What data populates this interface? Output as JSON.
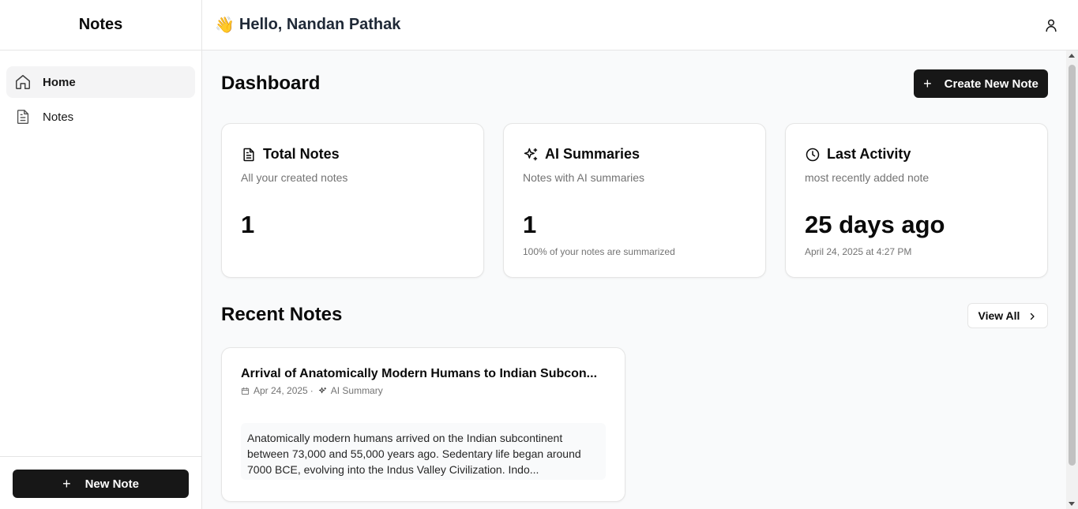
{
  "sidebar": {
    "app_title": "Notes",
    "items": [
      {
        "label": "Home",
        "icon": "home-icon",
        "active": true
      },
      {
        "label": "Notes",
        "icon": "document-icon",
        "active": false
      }
    ],
    "new_note_label": "New Note"
  },
  "header": {
    "wave": "👋",
    "greeting": "Hello, Nandan Pathak",
    "user_icon": "user-icon"
  },
  "main": {
    "title": "Dashboard",
    "create_label": "Create New Note",
    "cards": [
      {
        "title": "Total Notes",
        "icon": "file-text-icon",
        "description": "All your created notes",
        "value": "1",
        "sub": ""
      },
      {
        "title": "AI Summaries",
        "icon": "sparkles-icon",
        "description": "Notes with AI summaries",
        "value": "1",
        "sub": "100% of your notes are summarized"
      },
      {
        "title": "Last Activity",
        "icon": "clock-icon",
        "description": "most recently added note",
        "value": "25 days ago",
        "sub": "April 24, 2025 at 4:27 PM"
      }
    ],
    "recent": {
      "title": "Recent Notes",
      "view_all_label": "View All",
      "notes": [
        {
          "title": "Arrival of Anatomically Modern Humans to Indian Subcon...",
          "date": "Apr 24, 2025",
          "separator": "·",
          "badge": "AI Summary",
          "summary": "Anatomically modern humans arrived on the Indian subcontinent between 73,000 and 55,000 years ago. Sedentary life began around 7000 BCE, evolving into the Indus Valley Civilization. Indo..."
        }
      ]
    }
  },
  "colors": {
    "primary": "#171717",
    "muted_text": "#737373",
    "background": "#f9fafb",
    "border": "#e5e5e5"
  }
}
